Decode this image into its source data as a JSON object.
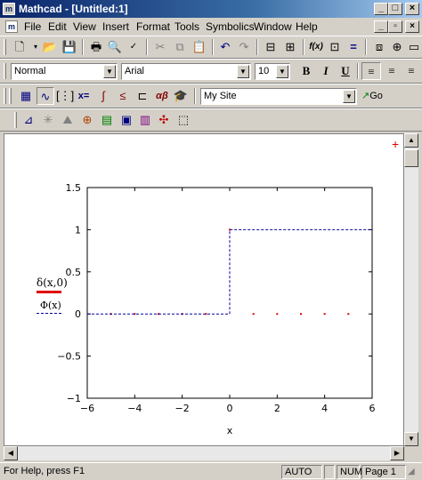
{
  "window": {
    "title": "Mathcad - [Untitled:1]",
    "min_icon": "minimize-icon",
    "max_icon": "maximize-icon",
    "close_icon": "close-icon"
  },
  "menu": {
    "items": [
      "File",
      "Edit",
      "View",
      "Insert",
      "Format",
      "Tools",
      "Symbolics",
      "Window",
      "Help"
    ]
  },
  "format_bar": {
    "style": "Normal",
    "font": "Arial",
    "size": "10",
    "bold": "B",
    "italic": "I",
    "underline": "U"
  },
  "math_bar": {
    "resource": "My Site",
    "go": "Go"
  },
  "document": {
    "region_marker": "+",
    "legend_1": "δ(x,0)",
    "legend_2": "Φ(x)",
    "legend_1_color": "#e00000",
    "legend_2_color": "#0000a0"
  },
  "chart_data": {
    "type": "line",
    "xlabel": "x",
    "ylabel": "",
    "xlim": [
      -6,
      6
    ],
    "ylim": [
      -1,
      1.5
    ],
    "x_ticks": [
      "−6",
      "−4",
      "−2",
      "0",
      "2",
      "4",
      "6"
    ],
    "y_ticks": [
      "1.5",
      "1",
      "0.5",
      "0",
      "−0.5",
      "−1"
    ],
    "series": [
      {
        "name": "δ(x,0)",
        "style": "points",
        "color": "#e00000",
        "points": [
          [
            -5,
            0
          ],
          [
            -4,
            0
          ],
          [
            -3,
            0
          ],
          [
            -2,
            0
          ],
          [
            -1,
            0
          ],
          [
            0,
            1
          ],
          [
            1,
            0
          ],
          [
            2,
            0
          ],
          [
            3,
            0
          ],
          [
            4,
            0
          ],
          [
            5,
            0
          ]
        ]
      },
      {
        "name": "Φ(x)",
        "style": "dashed",
        "color": "#0000a0",
        "points": [
          [
            -6,
            0
          ],
          [
            0,
            0
          ],
          [
            0,
            1
          ],
          [
            6,
            1
          ]
        ]
      }
    ]
  },
  "status": {
    "help": "For Help, press F1",
    "mode": "AUTO",
    "num": "NUM",
    "page": "Page 1"
  }
}
